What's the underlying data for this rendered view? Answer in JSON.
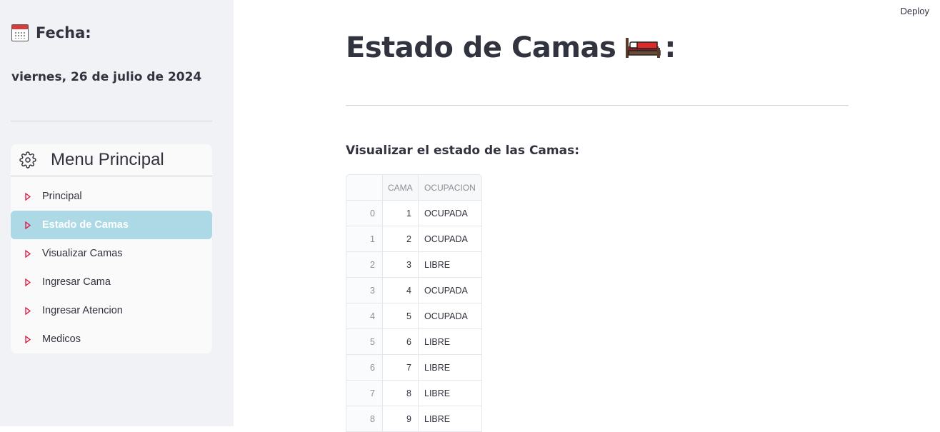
{
  "sidebar": {
    "fecha_label": "Fecha:",
    "fecha_icon": "calendar-icon",
    "fecha_value": "viernes, 26 de julio de 2024",
    "menu": {
      "title": "Menu Principal",
      "icon": "gear-icon",
      "items": [
        {
          "label": "Principal",
          "active": false
        },
        {
          "label": "Estado de Camas",
          "active": true
        },
        {
          "label": "Visualizar Camas",
          "active": false
        },
        {
          "label": "Ingresar Cama",
          "active": false
        },
        {
          "label": "Ingresar Atencion",
          "active": false
        },
        {
          "label": "Medicos",
          "active": false
        }
      ]
    }
  },
  "toolbar": {
    "deploy_label": "Deploy"
  },
  "main": {
    "title": "Estado de Camas",
    "title_suffix": ":",
    "title_icon": "bed-icon",
    "subtitle": "Visualizar el estado de las Camas:",
    "table": {
      "columns": [
        "",
        "CAMA",
        "OCUPACION"
      ],
      "rows": [
        {
          "index": "0",
          "cama": "1",
          "ocupacion": "OCUPADA"
        },
        {
          "index": "1",
          "cama": "2",
          "ocupacion": "OCUPADA"
        },
        {
          "index": "2",
          "cama": "3",
          "ocupacion": "LIBRE"
        },
        {
          "index": "3",
          "cama": "4",
          "ocupacion": "OCUPADA"
        },
        {
          "index": "4",
          "cama": "5",
          "ocupacion": "OCUPADA"
        },
        {
          "index": "5",
          "cama": "6",
          "ocupacion": "LIBRE"
        },
        {
          "index": "6",
          "cama": "7",
          "ocupacion": "LIBRE"
        },
        {
          "index": "7",
          "cama": "8",
          "ocupacion": "LIBRE"
        },
        {
          "index": "8",
          "cama": "9",
          "ocupacion": "LIBRE"
        }
      ]
    }
  },
  "colors": {
    "sidebar_bg": "#f0f2f6",
    "active_item_bg": "#add8e6",
    "menu_icon_red": "#e0103c",
    "text": "#31333f"
  }
}
